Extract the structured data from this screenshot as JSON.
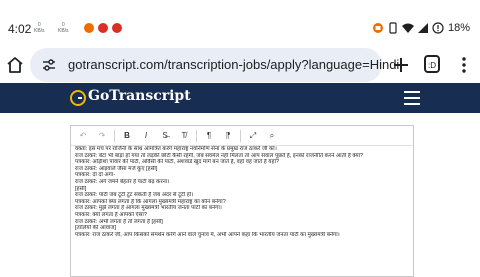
{
  "status_bar": {
    "time": "4:02",
    "net_1": {
      "value": "0",
      "unit": "KB/s"
    },
    "net_2": {
      "value": "0",
      "unit": "KB/s"
    },
    "battery": "18%",
    "app_icon_colors": [
      "#ef6c00",
      "#d93025",
      "#d93025"
    ]
  },
  "browser": {
    "url": "gotranscript.com/transcription-jobs/apply?language=Hindi",
    "tabs_count": ":D"
  },
  "site": {
    "logo_text": "GoTranscript",
    "header_color": "#172d51"
  },
  "editor": {
    "toolbar": [
      {
        "name": "undo-icon",
        "glyph": "↶"
      },
      {
        "name": "redo-icon",
        "glyph": "↷"
      },
      {
        "name": "bold-button",
        "glyph": "B"
      },
      {
        "name": "italic-button",
        "glyph": "I"
      },
      {
        "name": "strike-button",
        "glyph": "S̶"
      },
      {
        "name": "clear-format-button",
        "glyph": "T̸"
      },
      {
        "name": "ltr-button",
        "glyph": "¶"
      },
      {
        "name": "rtl-button",
        "glyph": "¶"
      },
      {
        "name": "maximize-button",
        "glyph": "⤢"
      },
      {
        "name": "find-button",
        "glyph": "⌕"
      }
    ],
    "lines": [
      "वक्ता: इस मंच पर राजिनी के साथ आमंत्रित करेंगे महाराष्ट्र नवनिर्माण सेना के प्रमुख राज ठाकरे जी को।",
      "राज ठाकरे: बेटा भी बाड़ा हो गया तो लड़की छोटी कैसी रहेगी, जब सवमेल नहीं मिलता तो आप सवाल पूछते हैं, इनको राजनीति करने आती है क्या?",
      "पत्रकार: ओड़ीशा पावार की पार्टी, ओवैसी की पार्टी, अशवाडे खुद मांगे बन जाते हैं, वहाँ वह जाते है यहाँ?",
      "राज ठाकरे: आइवाले जैसा मंजे कुए [हंसी]",
      "पत्रकार: दो दो अगा-",
      "राज ठाकरे: अगे जमने बेहतर है पार्टी बढ़ करना।",
      "[हंसी]",
      "राज ठाकरे: पार्टी जब टूटी टूट सकती है जब अंदर से टूटी हो।",
      "पत्रकार: आपको क्या लगता है कि आगला मुख्यमंत्री महाराष्ट्र का कौन बनेगा?",
      "राज ठाकरे: मुझे लगता है आगला मुख्यमंत्री भारतीय जनता पार्टी का बनेगा।",
      "पत्रकार: क्यों लगता है आपको ऐसा?",
      "राज ठाकरे: अभी लगता है तो लगता है [हंसी]",
      "[तालियों की आवाज]",
      "पत्रकार: राज ठाकरे जी, आप किसको समर्थन करेंगे आने वाले चुनाव में, अभी आपने कहा कि भारतीय जनता पार्टी का मुख्यमंत्री बनेगा।"
    ]
  }
}
